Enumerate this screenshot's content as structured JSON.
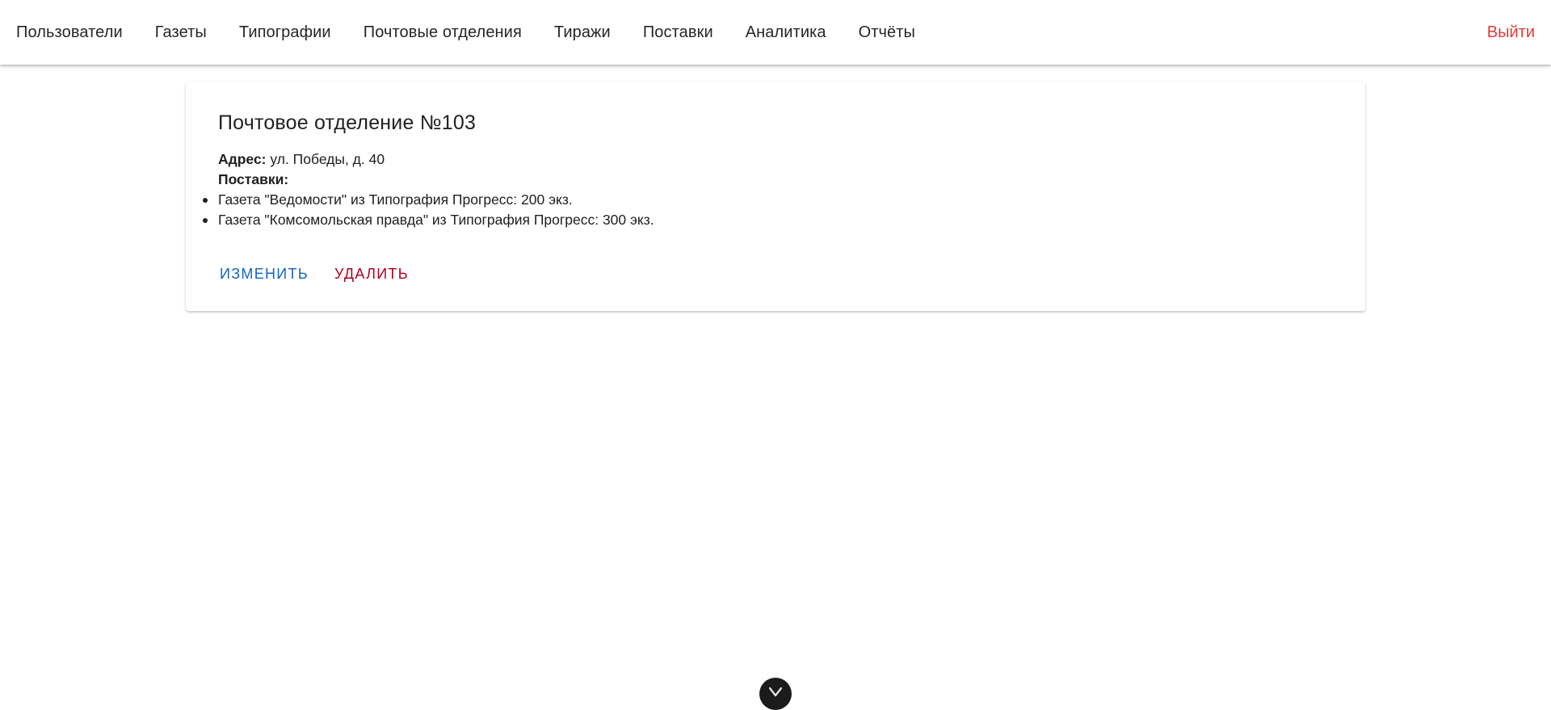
{
  "nav": {
    "items": [
      {
        "label": "Пользователи"
      },
      {
        "label": "Газеты"
      },
      {
        "label": "Типографии"
      },
      {
        "label": "Почтовые отделения"
      },
      {
        "label": "Тиражи"
      },
      {
        "label": "Поставки"
      },
      {
        "label": "Аналитика"
      },
      {
        "label": "Отчёты"
      }
    ],
    "logout_label": "Выйти"
  },
  "card": {
    "title": "Почтовое отделение №103",
    "address_label": "Адрес:",
    "address_value": "ул. Победы, д. 40",
    "deliveries_label": "Поставки:",
    "deliveries": [
      "Газета \"Ведомости\" из Типография Прогресс: 200 экз.",
      "Газета \"Комсомольская правда\" из Типография Прогресс: 300 экз."
    ],
    "edit_label": "Изменить",
    "delete_label": "Удалить"
  },
  "fab": {
    "icon": "chevron-down-icon"
  },
  "colors": {
    "logout": "#e53935",
    "edit": "#1565c0",
    "delete": "#b0001f"
  }
}
